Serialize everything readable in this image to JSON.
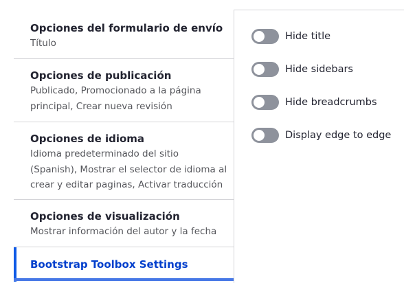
{
  "sidebar": {
    "tabs": [
      {
        "title": "Opciones del formulario de envío",
        "summary": "Título"
      },
      {
        "title": "Opciones de publicación",
        "summary": "Publicado, Promocionado a la página principal, Crear nueva revisión"
      },
      {
        "title": "Opciones de idioma",
        "summary": "Idioma predeterminado del sitio (Spanish), Mostrar el selector de idioma al crear y editar paginas, Activar traducción"
      },
      {
        "title": "Opciones de visualización",
        "summary": "Mostrar información del autor y la fecha"
      },
      {
        "title": "Bootstrap Toolbox Settings",
        "active": true
      }
    ]
  },
  "panel": {
    "toggles": [
      {
        "label": "Hide title",
        "checked": false
      },
      {
        "label": "Hide sidebars",
        "checked": false
      },
      {
        "label": "Hide breadcrumbs",
        "checked": false
      },
      {
        "label": "Display edge to edge",
        "checked": false
      }
    ]
  },
  "colors": {
    "active_tab_text": "#003ecc",
    "active_tab_bar": "#0f5ae6",
    "toggle_off": "#8e929c"
  }
}
